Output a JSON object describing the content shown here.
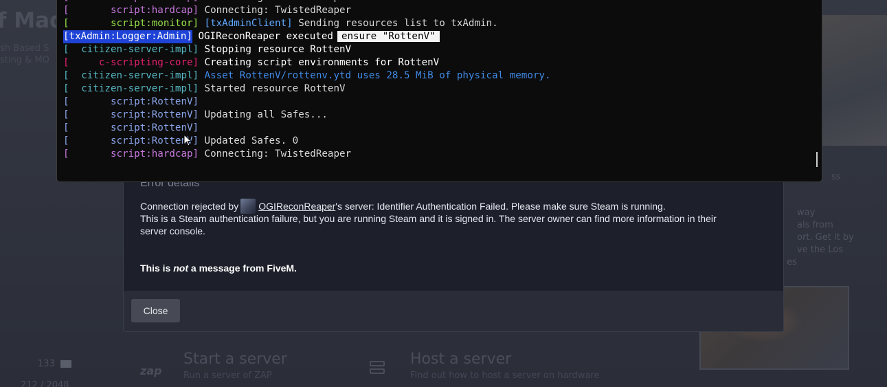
{
  "background": {
    "title": "f Made",
    "sub_lines": [
      "sh Based S",
      "sting & MO"
    ],
    "right_texts": [
      "way",
      "als from",
      "ort. Get it by",
      "ve the Los",
      "es",
      "ss"
    ],
    "count": "133",
    "players": "212 / 2048",
    "actions": [
      {
        "label": "Start a server",
        "sub": "Run a server of ZAP",
        "sub2": "hosting"
      },
      {
        "label": "Host a server",
        "sub": "Find out how to host a server on hardware",
        "sub2": "you control"
      }
    ],
    "zap_icon_text": "zap"
  },
  "console": {
    "lines": [
      {
        "channel": "script:hardcap",
        "channel_color": "#c678dd",
        "bracket_color": "#c678dd",
        "message": "Connecting: TwistedReaper",
        "message_color": "#d7d7d7"
      },
      {
        "channel": "script:hardcap",
        "channel_color": "#c678dd",
        "bracket_color": "#c678dd",
        "message": "Connecting: TwistedReaper",
        "message_color": "#d7d7d7"
      },
      {
        "channel": "script:monitor",
        "channel_color": "#98e24a",
        "bracket_color": "#98e24a",
        "message_prefix": "[txAdminClient]",
        "message_prefix_color": "#5fa8ff",
        "message": "Sending resources list to txAdmin.",
        "message_color": "#d7d7d7"
      },
      {
        "badge": "[txAdmin:Logger:Admin]",
        "message": "OGIReconReaper executed",
        "message_color": "#ffffff",
        "highlight": "ensure \"RottenV\""
      },
      {
        "channel": "citizen-server-impl",
        "channel_color": "#56b6c2",
        "bracket_color": "#56b6c2",
        "message": "Stopping resource RottenV",
        "message_color": "#ffffff"
      },
      {
        "channel": "c-scripting-core",
        "channel_color": "#e5206e",
        "bracket_color": "#e5206e",
        "message": "Creating script environments for RottenV",
        "message_color": "#ffffff"
      },
      {
        "channel": "citizen-server-impl",
        "channel_color": "#56b6c2",
        "bracket_color": "#56b6c2",
        "message": "Asset RottenV/rottenv.ytd uses 28.5 MiB of physical memory.",
        "message_color": "#3f8ae6"
      },
      {
        "channel": "citizen-server-impl",
        "channel_color": "#56b6c2",
        "bracket_color": "#56b6c2",
        "message": "Started resource RottenV",
        "message_color": "#d7d7d7"
      },
      {
        "channel": "script:RottenV",
        "channel_color": "#8aa4e8",
        "bracket_color": "#8aa4e8",
        "message": "",
        "message_color": "#d7d7d7"
      },
      {
        "channel": "script:RottenV",
        "channel_color": "#8aa4e8",
        "bracket_color": "#8aa4e8",
        "message": "Updating all Safes...",
        "message_color": "#d7d7d7"
      },
      {
        "channel": "script:RottenV",
        "channel_color": "#8aa4e8",
        "bracket_color": "#8aa4e8",
        "message": "",
        "message_color": "#d7d7d7"
      },
      {
        "channel": "script:RottenV",
        "channel_color": "#8aa4e8",
        "bracket_color": "#8aa4e8",
        "message": "Updated Safes. 0",
        "message_color": "#d7d7d7"
      },
      {
        "channel": "script:hardcap",
        "channel_color": "#c678dd",
        "bracket_color": "#c678dd",
        "message": "Connecting: TwistedReaper",
        "message_color": "#d7d7d7"
      }
    ]
  },
  "error_modal": {
    "title": "Error details",
    "line1_prefix": "Connection rejected by",
    "server_owner": "OGIReconReaper",
    "line1_suffix": "'s server: Identifier Authentication Failed. Please make sure Steam is running.",
    "line2": "This is a Steam authentication failure, but you are running Steam and it is signed in. The server owner can find more information in their",
    "line3": "server console.",
    "bold_prefix": "This is ",
    "bold_em": "not",
    "bold_suffix": " a message from FiveM.",
    "close_label": "Close"
  },
  "colors": {
    "console_bg": "#0c0c0c",
    "modal_bg": "#1d202b",
    "modal_footer_bg": "#2a2d37",
    "badge_bg": "#1f43d6"
  }
}
